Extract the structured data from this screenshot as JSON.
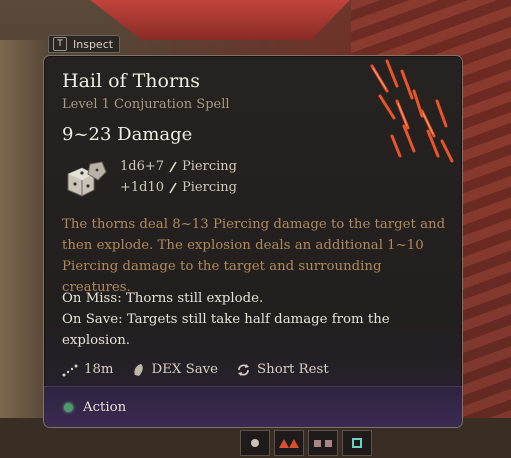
{
  "inspect": {
    "key": "T",
    "label": "Inspect"
  },
  "spell": {
    "name": "Hail of Thorns",
    "type": "Level 1 Conjuration Spell",
    "damage_summary": "9~23 Damage",
    "damage": [
      {
        "dice": "1d6+7",
        "type": "Piercing"
      },
      {
        "dice": "+1d10",
        "type": "Piercing"
      }
    ],
    "description": "The thorns deal 8~13 Piercing damage to the target and then explode. The explosion deals an additional 1~10 Piercing damage to the target and surrounding creatures.",
    "on_miss": "On Miss: Thorns still explode.",
    "on_save": "On Save: Targets still take half damage from the explosion.",
    "stats": {
      "range": "18m",
      "save": "DEX Save",
      "rest": "Short Rest"
    },
    "cost": "Action"
  },
  "colors": {
    "description": "#b08a5c",
    "action_dot": "#4f9a6d",
    "panel_bg": "#262221",
    "footer_bg": "#3b2a52"
  },
  "icons": [
    "dice-icon",
    "piercing-icon",
    "range-icon",
    "dex-save-icon",
    "short-rest-icon",
    "action-icon",
    "thorn-art"
  ]
}
